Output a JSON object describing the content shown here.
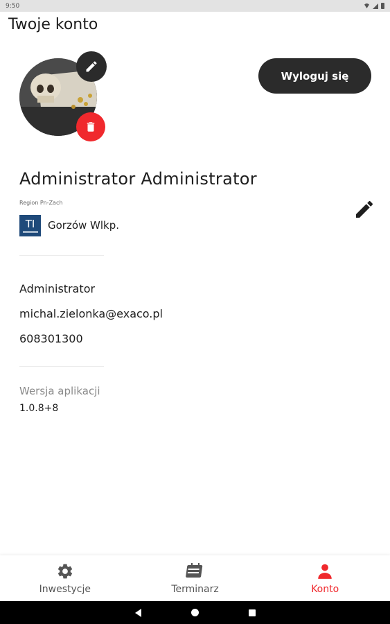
{
  "status_bar": {
    "time": "9:50"
  },
  "header": {
    "title": "Twoje konto"
  },
  "actions": {
    "logout_label": "Wyloguj się"
  },
  "profile": {
    "name": "Administrator Administrator",
    "region": "Region Pn-Zach",
    "org_logo_text": "TI",
    "city": "Gorzów Wlkp.",
    "role": "Administrator",
    "email": "michal.zielonka@exaco.pl",
    "phone": "608301300"
  },
  "app": {
    "version_label": "Wersja aplikacji",
    "version": "1.0.8+8"
  },
  "bottom_nav": {
    "items": [
      {
        "label": "Inwestycje",
        "icon": "gear-icon",
        "active": false
      },
      {
        "label": "Terminarz",
        "icon": "calendar-icon",
        "active": false
      },
      {
        "label": "Konto",
        "icon": "person-icon",
        "active": true
      }
    ]
  },
  "colors": {
    "accent": "#f0292d",
    "dark_button": "#2b2b2b",
    "logo_blue": "#1f4a7a"
  }
}
